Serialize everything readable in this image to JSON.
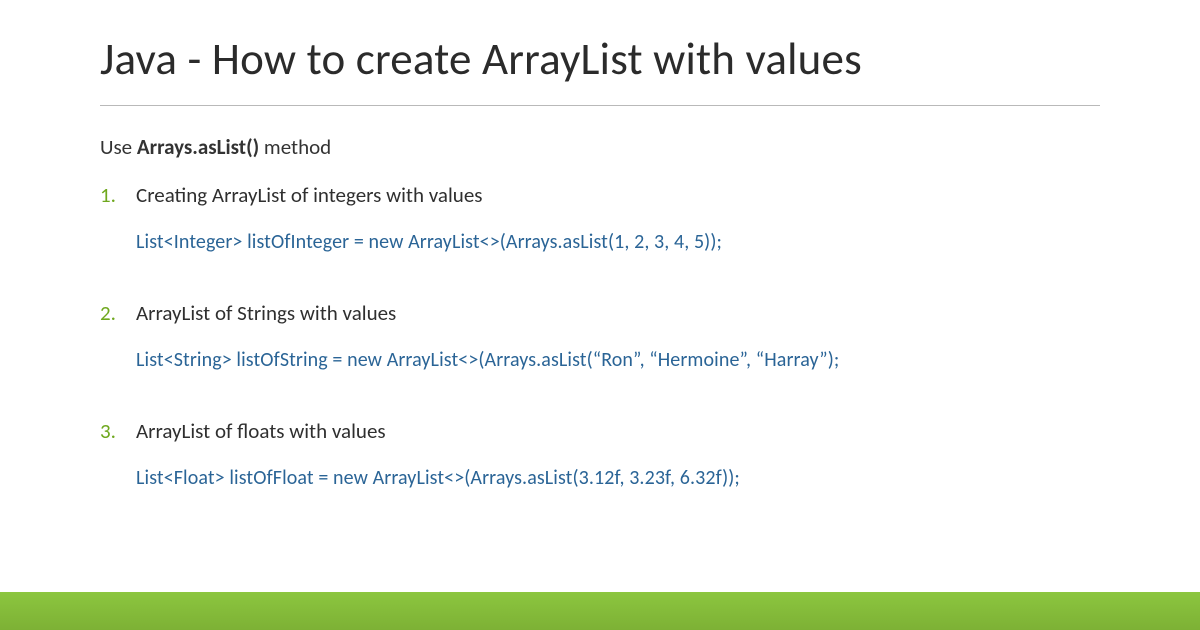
{
  "title": "Java - How to create ArrayList with values",
  "intro_prefix": "Use ",
  "intro_bold": "Arrays.asList()",
  "intro_suffix": " method",
  "items": [
    {
      "label": "Creating ArrayList of integers with values",
      "code": "List<Integer> listOfInteger = new ArrayList<>(Arrays.asList(1, 2, 3, 4, 5));"
    },
    {
      "label": "ArrayList of Strings with values",
      "code": "List<String> listOfString = new ArrayList<>(Arrays.asList(“Ron”, “Hermoine”, “Harray”);"
    },
    {
      "label": "ArrayList of floats with values",
      "code": "List<Float> listOfFloat = new ArrayList<>(Arrays.asList(3.12f, 3.23f, 6.32f));"
    }
  ],
  "colors": {
    "accent_green": "#6fa81e",
    "code_blue": "#2a6496",
    "footer_green": "#8cc63f"
  }
}
